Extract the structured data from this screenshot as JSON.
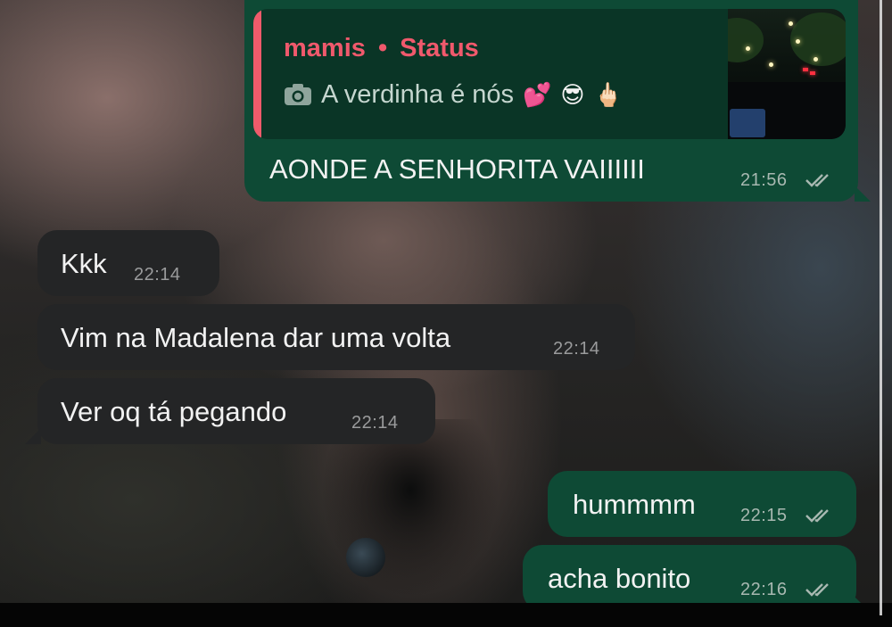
{
  "chat": {
    "quoted_status": {
      "author": "mamis",
      "separator": "•",
      "label": "Status",
      "caption": "A verdinha é nós",
      "caption_icon": "camera-icon",
      "emojis": [
        "💕",
        "😎",
        "🖕🏻"
      ]
    },
    "messages": [
      {
        "id": "m1",
        "direction": "outgoing",
        "text": "AONDE A SENHORITA VAIIIIII",
        "time": "21:56",
        "status": "read"
      },
      {
        "id": "m2",
        "direction": "incoming",
        "text": "Kkk",
        "time": "22:14"
      },
      {
        "id": "m3",
        "direction": "incoming",
        "text": "Vim na Madalena dar uma volta",
        "time": "22:14"
      },
      {
        "id": "m4",
        "direction": "incoming",
        "text": "Ver oq tá pegando",
        "time": "22:14"
      },
      {
        "id": "m5",
        "direction": "outgoing",
        "text": "hummmm",
        "time": "22:15",
        "status": "read"
      },
      {
        "id": "m6",
        "direction": "outgoing",
        "text": "acha bonito",
        "time": "22:16",
        "status": "read"
      }
    ]
  },
  "colors": {
    "outgoing_bubble": "#0e4a35",
    "incoming_bubble": "#242526",
    "quote_accent": "#ef5b6b",
    "quote_author": "#f0596c"
  }
}
